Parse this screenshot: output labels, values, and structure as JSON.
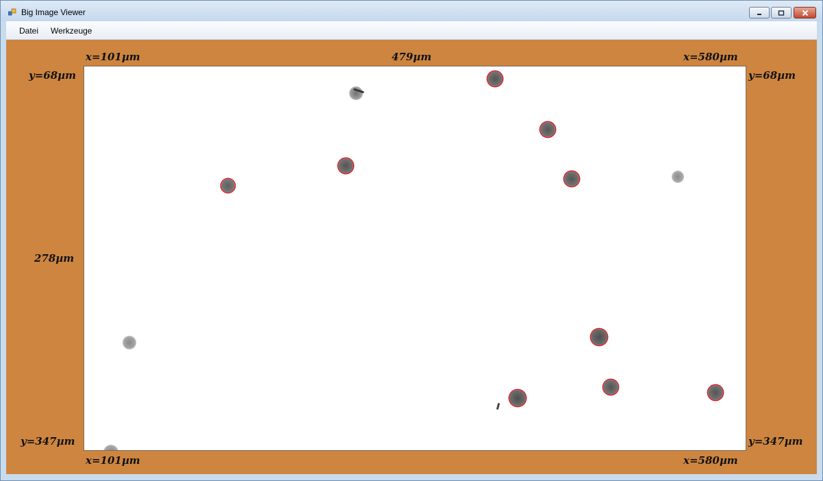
{
  "window": {
    "title": "Big Image Viewer",
    "icons": {
      "app": "app-windows-icon",
      "minimize": "minimize-icon",
      "maximize": "restore-icon",
      "close": "close-icon"
    }
  },
  "menu": {
    "items": [
      "Datei",
      "Werkzeuge"
    ]
  },
  "viewer": {
    "background_color": "#cd8540",
    "marker_color": "#e0141e",
    "labels": {
      "top_left": "x=101µm",
      "top_center": "479µm",
      "top_right": "x=580µm",
      "left_top": "y=68µm",
      "left_middle": "278µm",
      "left_bottom": "y=347µm",
      "right_top": "y=68µm",
      "right_bottom": "y=347µm",
      "bottom_left": "x=101µm",
      "bottom_right": "x=580µm"
    }
  }
}
